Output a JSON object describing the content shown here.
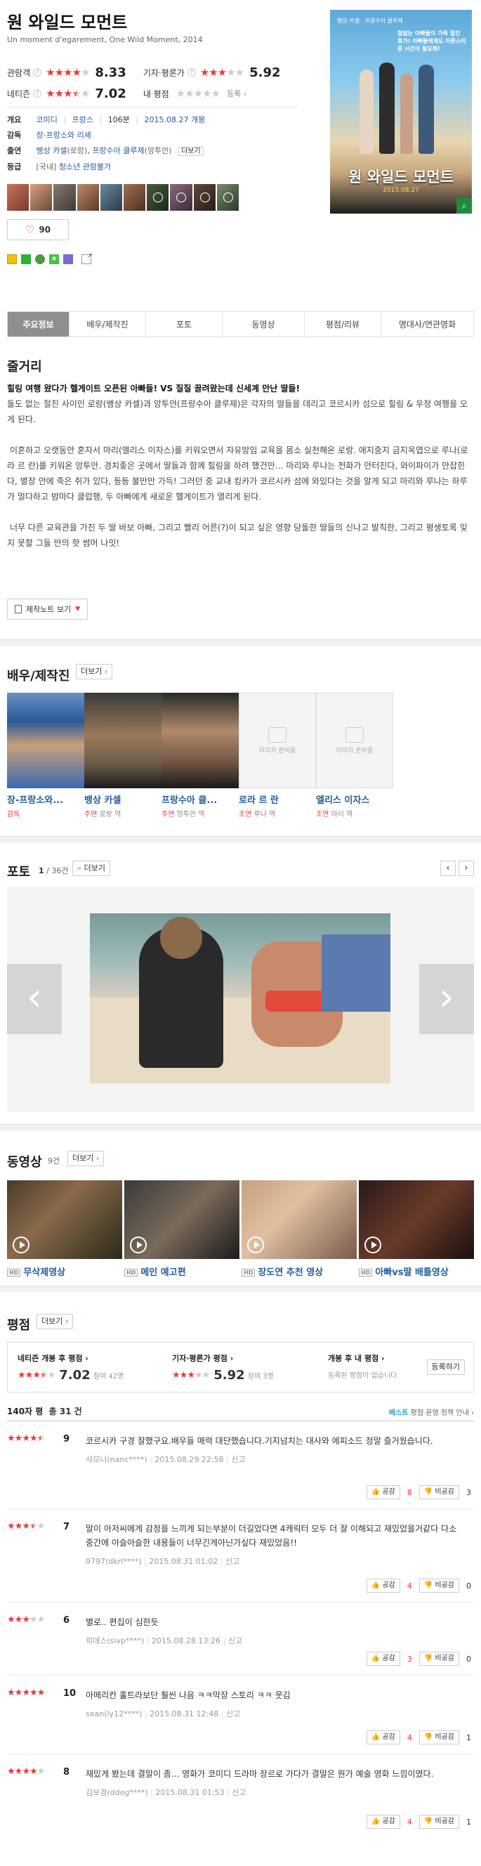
{
  "movie": {
    "title": "원 와일드 모먼트",
    "original": "Un moment d'egarement, One Wild Moment, 2014"
  },
  "ratings": {
    "audience_label": "관람객",
    "audience_score": "8.33",
    "audience_stars": 4.2,
    "critic_label": "기자·평론가",
    "critic_score": "5.92",
    "critic_stars": 3.0,
    "netizen_label": "네티즌",
    "netizen_score": "7.02",
    "netizen_stars": 3.5,
    "my_label": "내 평점",
    "my_stars": 0,
    "register": "등록"
  },
  "info": {
    "overview_label": "개요",
    "genre": "코미디",
    "country": "프랑스",
    "runtime": "106분",
    "release": "2015.08.27 개봉",
    "director_label": "감독",
    "director": "장-프랑소와 리셰",
    "cast_label": "출연",
    "cast_1": "뱅상 카셀",
    "cast_1_role": "(로랑)",
    "cast_2": "프랑수아 클루제",
    "cast_2_role": "(앙투안)",
    "more": "더보기",
    "grade_label": "등급",
    "grade_prefix": "[국내]",
    "grade": "청소년 관람불가"
  },
  "like_count": "90",
  "poster": {
    "title": "원 와일드 모먼트",
    "tagline": "철없는 아빠들이 가족 절친 휴가! 아빠들에게도 어른스러운 시간이 필요해!",
    "date": "2015.08.27"
  },
  "tabs": [
    "주요정보",
    "배우/제작진",
    "포토",
    "동영상",
    "평점/리뷰",
    "명대사/연관영화"
  ],
  "story": {
    "heading": "줄거리",
    "headline": "힐링 여행 왔다가 헬게이트 오픈된 아빠들! VS 질질 끌려왔는데 신세계 만난 딸들!",
    "p1": "둘도 없는 절친 사이인 로랑(뱅상 카셀)과 앙투안(프랑수아 클루제)은 각자의 딸들을 데리고 코르시카 섬으로 힐링 & 우정 여행을 오게 된다.",
    "p2": "이혼하고 오랫동안 혼자서 마리(엘리스 이자스)를 키워오면서 자유방임 교육을 몸소 실천해온 로랑. 애지중지 금지옥엽으로 루나(로라 르 란)를 키워온 앙투안. 경치좋은 곳에서 딸들과 함께 힐링을 하려 했건만… 마리와 루나는 전화가 안터진다, 와이파이가 안잡힌다, 별장 안에 죽은 쥐가 있다, 등등 불만만 가득! 그러던 중 교내 킹카가 코르시카 섬에 와있다는 것을 알게 되고 마리와 루나는 하루가 멀다하고 밤마다 클럽행, 두 아빠에게 새로운 헬게이트가 열리게 된다.",
    "p3": "너무 다른 교육관을 가진 두 딸 바보 아빠, 그리고 빨리 어른(?)이 되고 싶은 영향 당돌한 딸들의 신나고 발칙한, 그리고 평생토록 잊지 못할 그들 만의 핫 썸머 나잇!",
    "note_btn": "제작노트 보기"
  },
  "cast_section": {
    "heading": "배우/제작진",
    "more": "더보기",
    "no_image": "이미지 준비중",
    "people": [
      {
        "name": "장-프랑소와...",
        "role_type": "감독",
        "role": ""
      },
      {
        "name": "뱅상 카셀",
        "role_type": "주연",
        "role": "로랑 역"
      },
      {
        "name": "프랑수아 클...",
        "role_type": "주연",
        "role": "앙투안 역"
      },
      {
        "name": "로라 르 란",
        "role_type": "조연",
        "role": "루나 역"
      },
      {
        "name": "엘리스 이자스",
        "role_type": "조연",
        "role": "마리 역"
      }
    ]
  },
  "photo": {
    "heading": "포토",
    "count_current": "1",
    "count_total": "/ 36건",
    "more": "더보기"
  },
  "video": {
    "heading": "동영상",
    "count": "9건",
    "more": "더보기",
    "hd": "HD",
    "items": [
      "무삭제영상",
      "메인 예고편",
      "장도연 추천 영상",
      "아빠vs딸 배틀영상"
    ]
  },
  "review": {
    "heading": "평점",
    "more": "더보기",
    "netizen_label": "네티즌 개봉 후 평점",
    "netizen_score": "7.02",
    "netizen_count": "참여 42명",
    "critic_label": "기자·평론가 평점",
    "critic_score": "5.92",
    "critic_count": "참여 3명",
    "my_label": "개봉 후 내 평점",
    "my_text": "등록된 평점이 없습니다.",
    "register": "등록하기",
    "total_label": "140자 평",
    "total_count": "총 31 건",
    "policy_best": "베스트",
    "policy_text": "평점 운영 정책 안내",
    "agree": "공감",
    "disagree": "비공감",
    "report": "신고",
    "items": [
      {
        "stars": 4.5,
        "score": "9",
        "text": "코르시카 구경 잘했구요.배우들 매력 대단했습니다.기지넘치는 대사와 에피소드 정말 즐거웠습니다.",
        "user": "샤모니(nanc****)",
        "date": "2015.08.29 22:58",
        "agree": "8",
        "disagree": "3"
      },
      {
        "stars": 3.5,
        "score": "7",
        "text": "말이 아저씨에게 감정을 느끼게 되는부분이 더길었다면 4캐릭터 모두 더 잘 이해되고 재밌었을거같다 다소 중간에 아슬아슬한 내용들이 너무긴게아닌가싶다 재밌었음!!",
        "user": "9797(dkrl****)",
        "date": "2015.08.31 01:02",
        "agree": "4",
        "disagree": "0"
      },
      {
        "stars": 3.0,
        "score": "6",
        "text": "별로.. 편집이 심한듯",
        "user": "피데스(sivp****)",
        "date": "2015.08.28 13:26",
        "agree": "3",
        "disagree": "0"
      },
      {
        "stars": 5.0,
        "score": "10",
        "text": "아메리칸 홀트라보단 훨씬 나음 ㅋㅋ막장 스토리 ㅋㅋ 웃김",
        "user": "sean(ly12****)",
        "date": "2015.08.31 12:48",
        "agree": "4",
        "disagree": "1"
      },
      {
        "stars": 4.0,
        "score": "8",
        "text": "재밌게 봤는데 결말이 좀... 영화가 코미디 드라마 장르로 가다가 결말은 뭔가 예술 영화 느낌이였다.",
        "user": "김보경(ddeg****)",
        "date": "2015.08.31 01:53",
        "agree": "4",
        "disagree": "1"
      }
    ]
  },
  "colors": {
    "accent_red": "#e83a3a",
    "link_blue": "#245d9d",
    "tab_active": "#8f8f8f"
  }
}
